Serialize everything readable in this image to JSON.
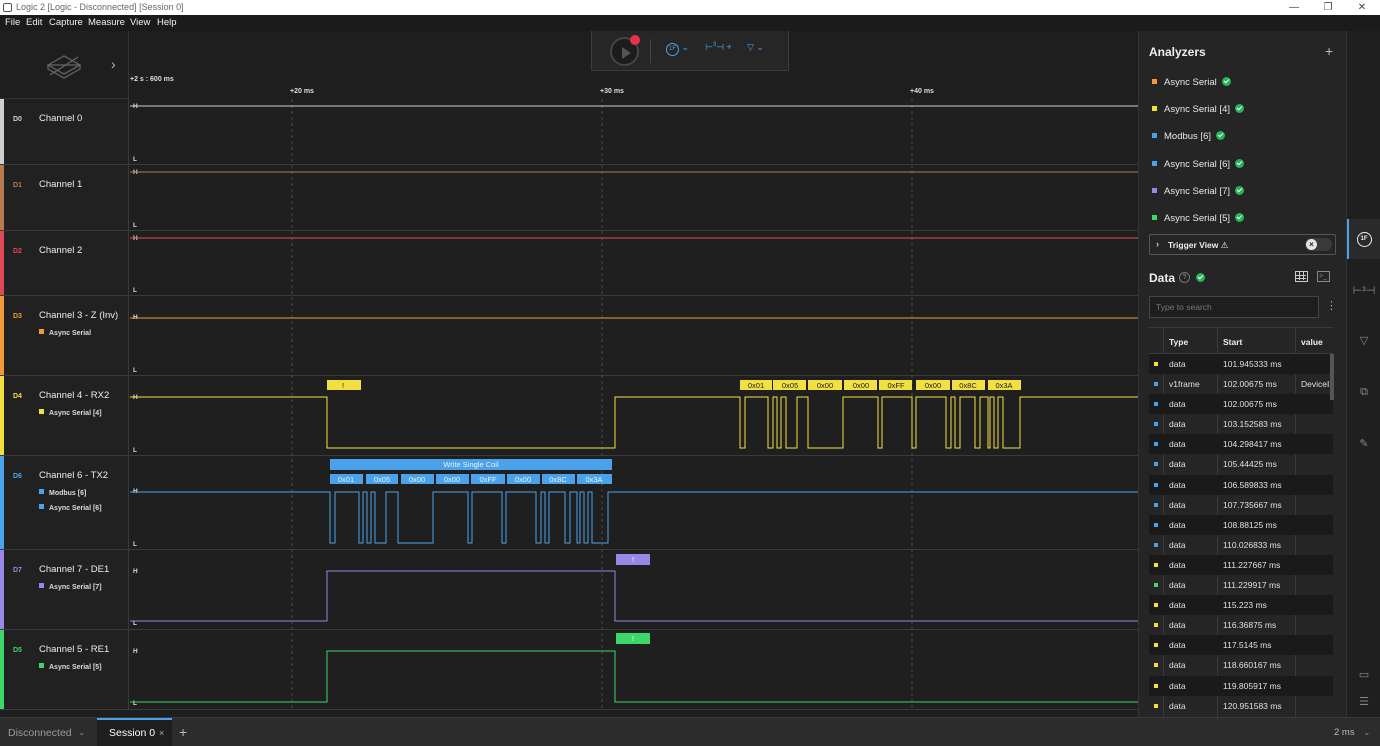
{
  "window": {
    "title": "Logic 2 [Logic - Disconnected] [Session 0]"
  },
  "menu": [
    "File",
    "Edit",
    "Capture",
    "Measure",
    "View",
    "Help"
  ],
  "ruler": {
    "start": "+2 s : 600 ms",
    "ticks": [
      "+20 ms",
      "+30 ms",
      "+40 ms"
    ]
  },
  "toolbar": {
    "trigger_icon_label": "1F",
    "timing_icon_label": "3",
    "marker_icon_label": "▽"
  },
  "level_labels": {
    "high": "H",
    "low": "L"
  },
  "channels": [
    {
      "id": "D0",
      "name": "Channel 0",
      "color": "#cfcfcf",
      "analyzers": []
    },
    {
      "id": "D1",
      "name": "Channel 1",
      "color": "#b87a4f",
      "analyzers": []
    },
    {
      "id": "D2",
      "name": "Channel 2",
      "color": "#e0485a",
      "analyzers": []
    },
    {
      "id": "D3",
      "name": "Channel 3 - Z (Inv)",
      "color": "#f29a3a",
      "analyzers": [
        {
          "name": "Async Serial",
          "color": "#f29a3a"
        }
      ]
    },
    {
      "id": "D4",
      "name": "Channel 4 - RX2",
      "color": "#f2e040",
      "analyzers": [
        {
          "name": "Async Serial [4]",
          "color": "#f2e040"
        }
      ]
    },
    {
      "id": "D6",
      "name": "Channel 6 - TX2",
      "color": "#4aa3ea",
      "analyzers": [
        {
          "name": "Modbus [6]",
          "color": "#4aa3ea"
        },
        {
          "name": "Async Serial [6]",
          "color": "#4aa3ea"
        }
      ]
    },
    {
      "id": "D7",
      "name": "Channel 7 - DE1",
      "color": "#9a86e6",
      "analyzers": [
        {
          "name": "Async Serial [7]",
          "color": "#9a86e6"
        }
      ]
    },
    {
      "id": "D5",
      "name": "Channel 5 - RE1",
      "color": "#3dd66b",
      "analyzers": [
        {
          "name": "Async Serial [5]",
          "color": "#3dd66b"
        }
      ]
    }
  ],
  "decodes": {
    "rx2_bytes": [
      "0x01",
      "0x05",
      "0x00",
      "0x00",
      "0xFF",
      "0x00",
      "0x8C",
      "0x3A"
    ],
    "rx2_error": "!",
    "tx2_frame": "Write Single Coil",
    "tx2_bytes": [
      "0x01",
      "0x05",
      "0x00",
      "0x00",
      "0xFF",
      "0x00",
      "0x8C",
      "0x3A"
    ],
    "de1_error": "!",
    "re1_error": "!"
  },
  "analyzers": {
    "title": "Analyzers",
    "add_label": "+",
    "items": [
      {
        "name": "Async Serial",
        "color": "#f29a3a"
      },
      {
        "name": "Async Serial [4]",
        "color": "#f2e040"
      },
      {
        "name": "Modbus [6]",
        "color": "#4aa3ea"
      },
      {
        "name": "Async Serial [6]",
        "color": "#4aa3ea"
      },
      {
        "name": "Async Serial [7]",
        "color": "#9a86e6"
      },
      {
        "name": "Async Serial [5]",
        "color": "#3dd66b"
      }
    ],
    "trigger_view": "Trigger View ⚠",
    "trigger_toggle_icon": "x-icon"
  },
  "data": {
    "title": "Data",
    "help": "?",
    "search_placeholder": "Type to search",
    "columns": [
      "Type",
      "Start",
      "value"
    ],
    "rows": [
      {
        "type": "data",
        "start": "101.945333 ms",
        "value": "",
        "color": "#f2e040"
      },
      {
        "type": "v1frame",
        "start": "102.00675 ms",
        "value": "DeviceI",
        "color": "#4aa3ea"
      },
      {
        "type": "data",
        "start": "102.00675 ms",
        "value": "",
        "color": "#4aa3ea"
      },
      {
        "type": "data",
        "start": "103.152583 ms",
        "value": "",
        "color": "#4aa3ea"
      },
      {
        "type": "data",
        "start": "104.298417 ms",
        "value": "",
        "color": "#4aa3ea"
      },
      {
        "type": "data",
        "start": "105.44425 ms",
        "value": "",
        "color": "#4aa3ea"
      },
      {
        "type": "data",
        "start": "106.589833 ms",
        "value": "",
        "color": "#4aa3ea"
      },
      {
        "type": "data",
        "start": "107.735667 ms",
        "value": "",
        "color": "#4aa3ea"
      },
      {
        "type": "data",
        "start": "108.88125 ms",
        "value": "",
        "color": "#4aa3ea"
      },
      {
        "type": "data",
        "start": "110.026833 ms",
        "value": "",
        "color": "#4aa3ea"
      },
      {
        "type": "data",
        "start": "111.227667 ms",
        "value": "",
        "color": "#f2e040"
      },
      {
        "type": "data",
        "start": "111.229917 ms",
        "value": "",
        "color": "#3dd66b"
      },
      {
        "type": "data",
        "start": "115.223 ms",
        "value": "",
        "color": "#f2e040"
      },
      {
        "type": "data",
        "start": "116.36875 ms",
        "value": "",
        "color": "#f2e040"
      },
      {
        "type": "data",
        "start": "117.5145 ms",
        "value": "",
        "color": "#f2e040"
      },
      {
        "type": "data",
        "start": "118.660167 ms",
        "value": "",
        "color": "#f2e040"
      },
      {
        "type": "data",
        "start": "119.805917 ms",
        "value": "",
        "color": "#f2e040"
      },
      {
        "type": "data",
        "start": "120.951583 ms",
        "value": "",
        "color": "#f2e040"
      }
    ]
  },
  "bottom": {
    "status": "Disconnected",
    "session_tab": "Session 0",
    "close_tab": "×",
    "add_tab": "+",
    "zoom": "2 ms"
  }
}
